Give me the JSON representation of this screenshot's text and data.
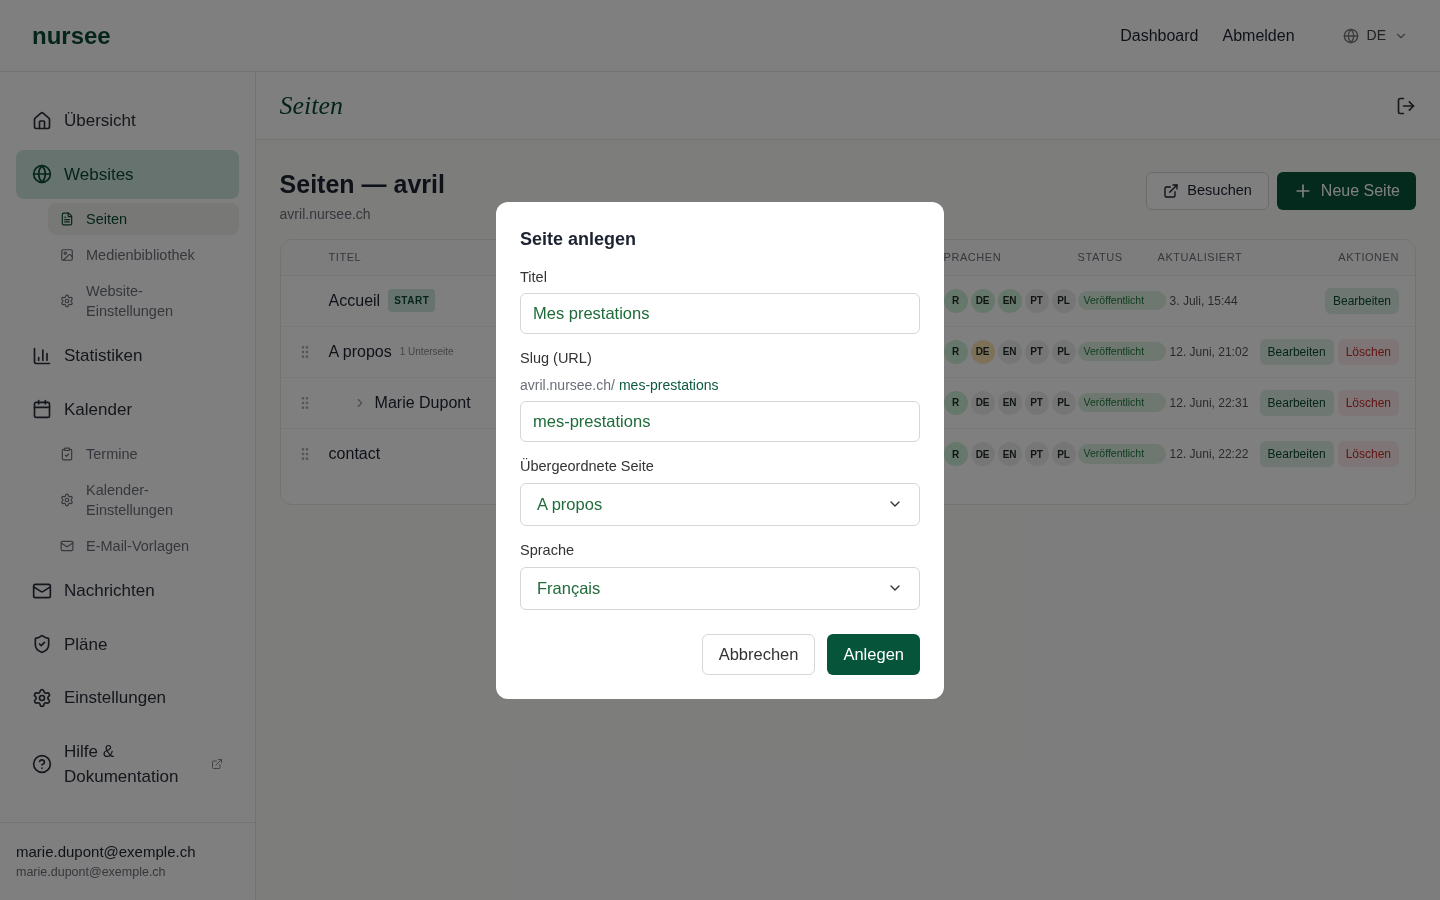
{
  "topbar": {
    "logo": "nursee",
    "links": [
      {
        "label": "Dashboard"
      },
      {
        "label": "Abmelden"
      }
    ],
    "language": "DE"
  },
  "sidebar": {
    "items": [
      {
        "label": "Übersicht",
        "kind": "main",
        "selected": false
      },
      {
        "label": "Websites",
        "kind": "main",
        "selected": true,
        "children": [
          {
            "label": "Seiten",
            "selected": true
          },
          {
            "label": "Medienbibliothek",
            "selected": false
          },
          {
            "label": "Website-Einstellungen",
            "selected": false
          }
        ]
      },
      {
        "label": "Statistiken",
        "kind": "main",
        "selected": false
      },
      {
        "label": "Kalender",
        "kind": "main",
        "selected": false,
        "children": [
          {
            "label": "Termine",
            "selected": false
          },
          {
            "label": "Kalender-Einstellungen",
            "selected": false
          },
          {
            "label": "E-Mail-Vorlagen",
            "selected": false
          }
        ]
      },
      {
        "label": "Nachrichten",
        "kind": "main",
        "selected": false
      },
      {
        "label": "Pläne",
        "kind": "main",
        "selected": false
      },
      {
        "label": "Einstellungen",
        "kind": "main",
        "selected": false
      },
      {
        "label": "Hilfe & Dokumentation",
        "kind": "external",
        "selected": false
      }
    ],
    "user": {
      "name": "marie.dupont@exemple.ch",
      "email": "marie.dupont@exemple.ch"
    }
  },
  "main": {
    "section_title": "Seiten",
    "title": "Seiten — avril",
    "domain": "avril.nursee.ch",
    "buttons": [
      {
        "label": "Besuchen",
        "kind": "secondary"
      },
      {
        "label": "Neue Seite",
        "kind": "primary"
      }
    ]
  },
  "table": {
    "columns": {
      "title": "TITEL",
      "languages": "PRACHEN",
      "status": "STATUS",
      "updated": "AKTUALISIERT",
      "actions": "AKTIONEN"
    },
    "rows": [
      {
        "title": "Accueil",
        "badge": "START",
        "nested": false,
        "draggable": false,
        "languages": [
          {
            "code": "R",
            "color": "#66776b"
          },
          {
            "code": "DE",
            "color": "#66776b"
          },
          {
            "code": "EN",
            "color": "#66776b"
          },
          {
            "code": "PT",
            "color": "#767676"
          },
          {
            "code": "PL",
            "color": "#767676"
          }
        ],
        "status": "Veröffentlicht",
        "updated": "3. Juli, 15:44",
        "actions": [
          "Bearbeiten"
        ]
      },
      {
        "title": "A propos",
        "note": "1 Unterseite",
        "nested": false,
        "draggable": true,
        "languages": [
          {
            "code": "R",
            "color": "#66776b"
          },
          {
            "code": "DE",
            "color": "#7d715a"
          },
          {
            "code": "EN",
            "color": "#767676"
          },
          {
            "code": "PT",
            "color": "#767676"
          },
          {
            "code": "PL",
            "color": "#767676"
          }
        ],
        "status": "Veröffentlicht",
        "updated": "12. Juni, 21:02",
        "actions": [
          "Bearbeiten",
          "Löschen"
        ]
      },
      {
        "title": "Marie Dupont",
        "nested": true,
        "draggable": true,
        "languages": [
          {
            "code": "R",
            "color": "#66776b"
          },
          {
            "code": "DE",
            "color": "#767676"
          },
          {
            "code": "EN",
            "color": "#767676"
          },
          {
            "code": "PT",
            "color": "#767676"
          },
          {
            "code": "PL",
            "color": "#767676"
          }
        ],
        "status": "Veröffentlicht",
        "updated": "12. Juni, 22:31",
        "actions": [
          "Bearbeiten",
          "Löschen"
        ]
      },
      {
        "title": "contact",
        "nested": false,
        "draggable": true,
        "languages": [
          {
            "code": "R",
            "color": "#66776b"
          },
          {
            "code": "DE",
            "color": "#767676"
          },
          {
            "code": "EN",
            "color": "#767676"
          },
          {
            "code": "PT",
            "color": "#767676"
          },
          {
            "code": "PL",
            "color": "#767676"
          }
        ],
        "status": "Veröffentlicht",
        "updated": "12. Juni, 22:22",
        "actions": [
          "Bearbeiten",
          "Löschen"
        ]
      }
    ]
  },
  "dialog": {
    "title": "Seite anlegen",
    "fields": [
      {
        "kind": "text",
        "label": "Titel",
        "value": "Mes prestations"
      },
      {
        "kind": "slug",
        "label": "Slug (URL)",
        "prefix": "avril.nursee.ch/",
        "preview": "mes-prestations",
        "value": "mes-prestations"
      },
      {
        "kind": "select",
        "label": "Übergeordnete Seite",
        "value": "A propos"
      },
      {
        "kind": "select",
        "label": "Sprache",
        "value": "Français"
      }
    ],
    "buttons": [
      {
        "label": "Abbrechen",
        "kind": "secondary"
      },
      {
        "label": "Anlegen",
        "kind": "primary"
      }
    ]
  }
}
